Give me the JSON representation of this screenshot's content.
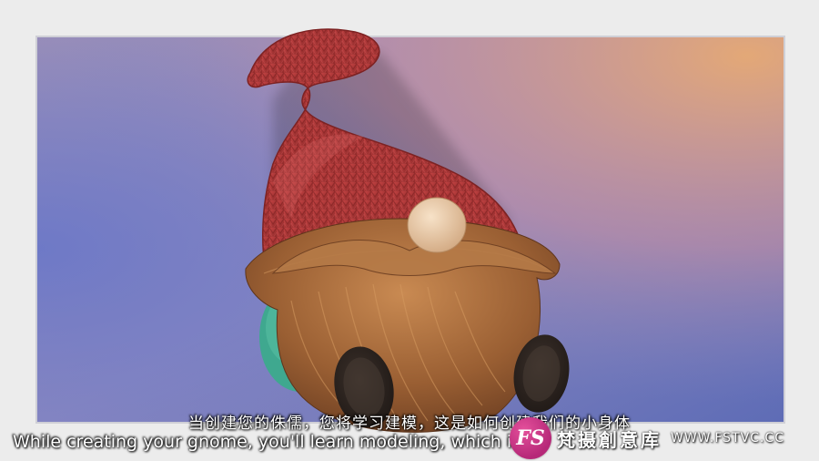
{
  "subtitles": {
    "chinese": "当创建您的侏儒，您将学习建模，这是如何创建我们的小身体",
    "english": "While creating your gnome, you'll learn modeling, which is h"
  },
  "watermark": {
    "badge": "FS",
    "brand": "梵摄創意库",
    "url": "WWW.FSTVC.CC"
  },
  "colors": {
    "frame": "#ececec",
    "bg_top_right": "#d8a07e",
    "bg_left": "#6e72b8",
    "hat": "#b03434",
    "beard": "#a8693a",
    "nose": "#e8c7a2",
    "body": "#3fa88f",
    "boots": "#2e2521",
    "watermark_badge": "#c8337f"
  }
}
